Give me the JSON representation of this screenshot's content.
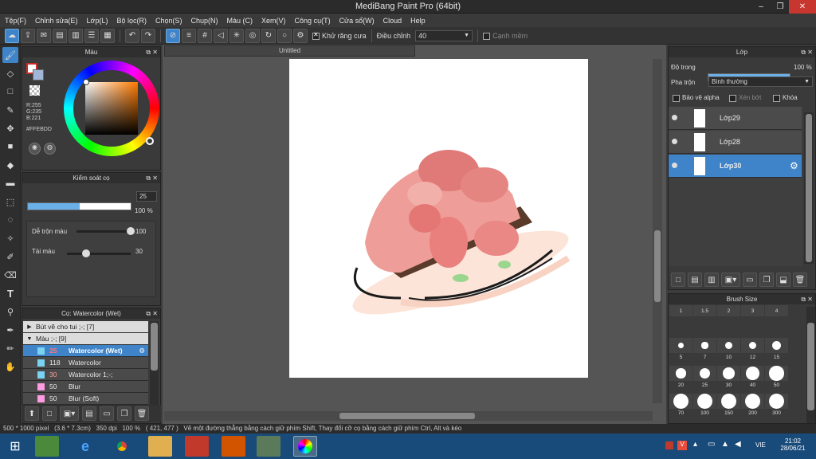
{
  "window": {
    "title": "MediBang Paint Pro (64bit)",
    "minimize": "–",
    "restore": "❐",
    "close": "✕"
  },
  "menu": [
    "Tệp(F)",
    "Chỉnh sửa(E)",
    "Lớp(L)",
    "Bộ lọc(R)",
    "Chọn(S)",
    "Chụp(N)",
    "Màu (C)",
    "Xem(V)",
    "Công cụ(T)",
    "Cửa sổ(W)",
    "Cloud",
    "Help"
  ],
  "toolbar": {
    "antialias_label": "Khử răng cưa",
    "adjust_label": "Điều chỉnh",
    "adjust_value": "40",
    "smooth_label": "Cạnh mềm"
  },
  "color_panel": {
    "title": "Màu",
    "r": "R:255",
    "g": "G:235",
    "b": "B:221",
    "hex": "#FFEBDD"
  },
  "brush_control": {
    "title": "Kiểm soát cọ",
    "size_value": "25",
    "size_fraction": 0.5,
    "opacity_value": "100 %",
    "opacity_fraction": 1.0,
    "blend_label": "Dễ trộn màu",
    "blend_value": "100",
    "blend_fraction": 1.0,
    "refill_label": "Tải màu",
    "refill_value": "30",
    "refill_fraction": 0.3
  },
  "brush_list": {
    "title": "Cọ: Watercolor (Wet)",
    "groups": [
      {
        "label": "Bút vẽ cho tui ;-; [7]",
        "arrow": "▶"
      },
      {
        "label": "Màu ;-; [9]",
        "arrow": "▼"
      }
    ],
    "items": [
      {
        "size": "25",
        "name": "Watercolor (Wet)",
        "color": "#7ad3f0",
        "num_color": "#ff7a7a",
        "selected": true
      },
      {
        "size": "118",
        "name": "Watercolor",
        "color": "#7ad3f0",
        "num_color": "#e8e8e8",
        "selected": false
      },
      {
        "size": "30",
        "name": "Watercolor 1;-;",
        "color": "#7ad3f0",
        "num_color": "#ff9b9b",
        "selected": false
      },
      {
        "size": "50",
        "name": "Blur",
        "color": "#ff9be0",
        "num_color": "#e8e8e8",
        "selected": false
      },
      {
        "size": "50",
        "name": "Blur (Soft)",
        "color": "#ff9be0",
        "num_color": "#e8e8e8",
        "selected": false
      }
    ]
  },
  "canvas": {
    "tab_title": "Untitled"
  },
  "layers_panel": {
    "title": "Lớp",
    "opacity_label": "Độ trong",
    "opacity_value": "100 %",
    "blend_label": "Pha trộn",
    "blend_value": "Bình thường",
    "protect_alpha": "Bảo vệ alpha",
    "clipping": "Xén bớt",
    "lock": "Khóa",
    "layers": [
      {
        "name": "Lớp29",
        "selected": false
      },
      {
        "name": "Lớp28",
        "selected": false
      },
      {
        "name": "Lớp30",
        "selected": true
      }
    ]
  },
  "brush_size_panel": {
    "title": "Brush Size",
    "sizes": [
      "1",
      "1.5",
      "2",
      "3",
      "4",
      "5",
      "7",
      "10",
      "12",
      "15",
      "20",
      "25",
      "30",
      "40",
      "50",
      "70",
      "100",
      "150",
      "200",
      "300"
    ]
  },
  "status_bar": {
    "dimensions": "500 * 1000 pixel",
    "physical": "(3.6 * 7.3cm)",
    "dpi": "350 dpi",
    "zoom": "100 %",
    "coords": "( 421, 477 )",
    "hint": "Vẽ một đường thẳng bằng cách giữ phím Shift, Thay đổi cỡ cọ bằng cách giữ phím Ctrl, Alt và kéo"
  },
  "taskbar": {
    "lang": "VIE",
    "time": "21:02",
    "date": "28/06/21"
  }
}
